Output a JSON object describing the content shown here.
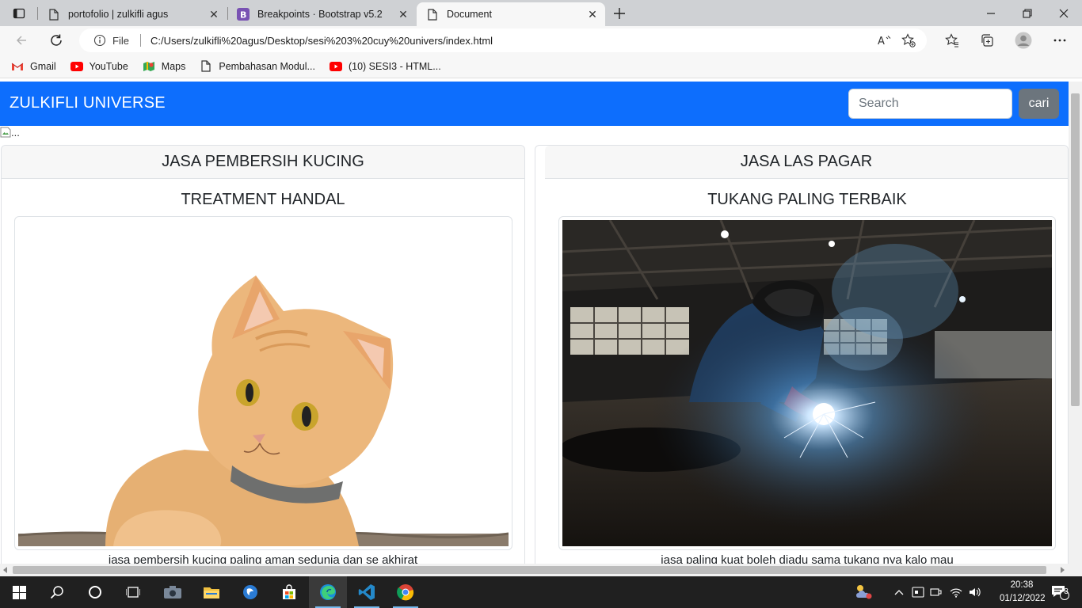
{
  "browser": {
    "tabs": [
      {
        "title": "portofolio | zulkifli agus",
        "icon": "page-icon"
      },
      {
        "title": "Breakpoints · Bootstrap v5.2",
        "icon": "bootstrap-icon"
      },
      {
        "title": "Document",
        "icon": "page-icon",
        "active": true
      }
    ],
    "address": {
      "scheme_label": "File",
      "url": "C:/Users/zulkifli%20agus/Desktop/sesi%203%20cuy%20univers/index.html"
    },
    "bookmarks": [
      {
        "label": "Gmail",
        "icon": "gmail-icon"
      },
      {
        "label": "YouTube",
        "icon": "youtube-icon"
      },
      {
        "label": "Maps",
        "icon": "maps-icon"
      },
      {
        "label": "Pembahasan Modul...",
        "icon": "page-icon"
      },
      {
        "label": "(10) SESI3 - HTML...",
        "icon": "youtube-icon"
      }
    ]
  },
  "page": {
    "brand": "ZULKIFLI UNIVERSE",
    "search": {
      "placeholder": "Search",
      "button_label": "cari"
    },
    "broken_image_alt": "...",
    "cards": [
      {
        "header": "JASA PEMBERSIH KUCING",
        "title": "TREATMENT HANDAL",
        "image": "orange-cat-photo",
        "text": "jasa pembersih kucing paling aman sedunia dan se akhirat"
      },
      {
        "header": "JASA LAS PAGAR",
        "title": "TUKANG PALING TERBAIK",
        "image": "welder-photo",
        "text": "jasa paling kuat boleh diadu sama tukang nya kalo mau"
      }
    ]
  },
  "taskbar": {
    "time": "20:38",
    "date": "01/12/2022",
    "notification_count": "3"
  },
  "colors": {
    "navbar_bg": "#0d6efd",
    "button_secondary": "#6c757d",
    "taskbar_bg": "#202020"
  }
}
